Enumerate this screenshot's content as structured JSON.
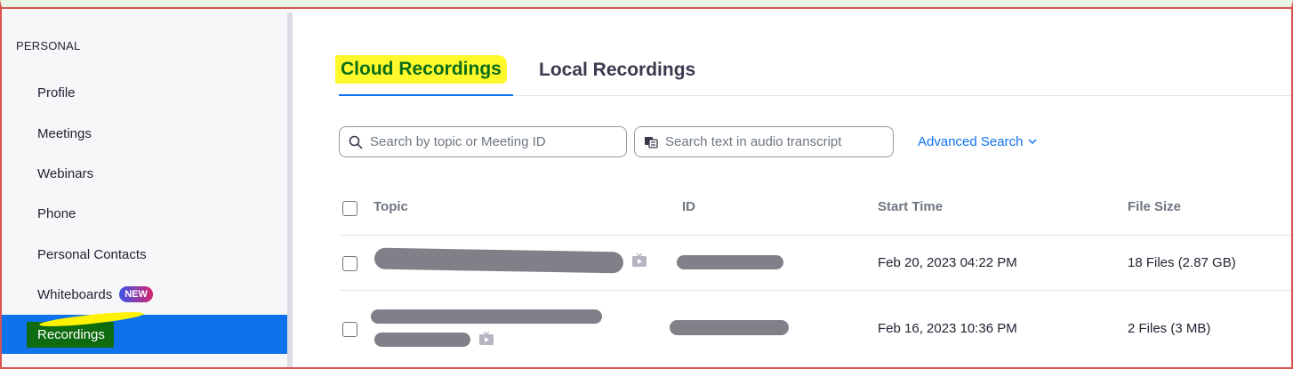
{
  "sidebar": {
    "section_label": "PERSONAL",
    "items": [
      {
        "label": "Profile"
      },
      {
        "label": "Meetings"
      },
      {
        "label": "Webinars"
      },
      {
        "label": "Phone"
      },
      {
        "label": "Personal Contacts"
      },
      {
        "label": "Whiteboards",
        "badge": "NEW"
      },
      {
        "label": "Recordings",
        "active": true
      }
    ]
  },
  "tabs": [
    {
      "label": "Cloud Recordings",
      "active": true
    },
    {
      "label": "Local Recordings"
    }
  ],
  "search": {
    "topic_placeholder": "Search by topic or Meeting ID",
    "transcript_placeholder": "Search text in audio transcript",
    "advanced_label": "Advanced Search"
  },
  "table": {
    "headers": {
      "topic": "Topic",
      "id": "ID",
      "start_time": "Start Time",
      "file_size": "File Size"
    },
    "rows": [
      {
        "start_time": "Feb 20, 2023 04:22 PM",
        "file_size": "18 Files (2.87 GB)"
      },
      {
        "start_time": "Feb 16, 2023 10:36 PM",
        "file_size": "2 Files (3 MB)"
      }
    ]
  },
  "colors": {
    "accent": "#0e72ed",
    "highlight": "#fff200",
    "redaction": "#808088"
  }
}
